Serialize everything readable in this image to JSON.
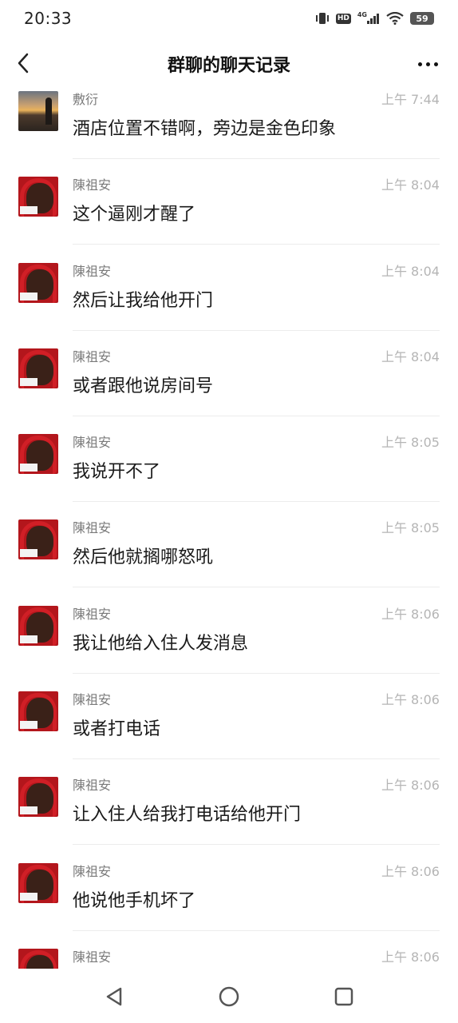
{
  "status_bar": {
    "time": "20:33",
    "hd": "HD",
    "network": "4G",
    "battery": "59"
  },
  "header": {
    "title": "群聊的聊天记录"
  },
  "messages": [
    {
      "sender": "敷衍",
      "time": "上午 7:44",
      "text": "酒店位置不错啊，旁边是金色印象",
      "avatar": "sunset-avatar"
    },
    {
      "sender": "陳祖安",
      "time": "上午 8:04",
      "text": "这个逼刚才醒了",
      "avatar": "kid-avatar"
    },
    {
      "sender": "陳祖安",
      "time": "上午 8:04",
      "text": "然后让我给他开门",
      "avatar": "kid-avatar"
    },
    {
      "sender": "陳祖安",
      "time": "上午 8:04",
      "text": "或者跟他说房间号",
      "avatar": "kid-avatar"
    },
    {
      "sender": "陳祖安",
      "time": "上午 8:05",
      "text": "我说开不了",
      "avatar": "kid-avatar"
    },
    {
      "sender": "陳祖安",
      "time": "上午 8:05",
      "text": "然后他就搁哪怒吼",
      "avatar": "kid-avatar"
    },
    {
      "sender": "陳祖安",
      "time": "上午 8:06",
      "text": "我让他给入住人发消息",
      "avatar": "kid-avatar"
    },
    {
      "sender": "陳祖安",
      "time": "上午 8:06",
      "text": "或者打电话",
      "avatar": "kid-avatar"
    },
    {
      "sender": "陳祖安",
      "time": "上午 8:06",
      "text": "让入住人给我打电话给他开门",
      "avatar": "kid-avatar"
    },
    {
      "sender": "陳祖安",
      "time": "上午 8:06",
      "text": "他说他手机坏了",
      "avatar": "kid-avatar"
    },
    {
      "sender": "陳祖安",
      "time": "上午 8:06",
      "text": "",
      "avatar": "kid-avatar"
    }
  ],
  "colors": {
    "background": "#ffffff",
    "sender_text": "#7a7a7a",
    "time_text": "#b5b5b5",
    "message_text": "#1a1a1a",
    "divider": "#ececec"
  }
}
